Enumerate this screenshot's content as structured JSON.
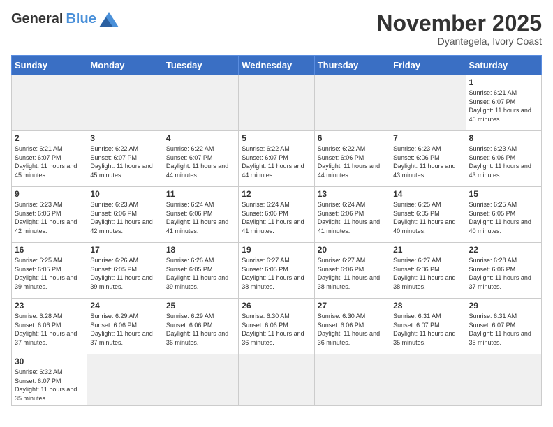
{
  "header": {
    "logo_general": "General",
    "logo_blue": "Blue",
    "title": "November 2025",
    "location": "Dyantegela, Ivory Coast"
  },
  "weekdays": [
    "Sunday",
    "Monday",
    "Tuesday",
    "Wednesday",
    "Thursday",
    "Friday",
    "Saturday"
  ],
  "weeks": [
    [
      {
        "day": "",
        "text": ""
      },
      {
        "day": "",
        "text": ""
      },
      {
        "day": "",
        "text": ""
      },
      {
        "day": "",
        "text": ""
      },
      {
        "day": "",
        "text": ""
      },
      {
        "day": "",
        "text": ""
      },
      {
        "day": "1",
        "text": "Sunrise: 6:21 AM\nSunset: 6:07 PM\nDaylight: 11 hours and 46 minutes."
      }
    ],
    [
      {
        "day": "2",
        "text": "Sunrise: 6:21 AM\nSunset: 6:07 PM\nDaylight: 11 hours and 45 minutes."
      },
      {
        "day": "3",
        "text": "Sunrise: 6:22 AM\nSunset: 6:07 PM\nDaylight: 11 hours and 45 minutes."
      },
      {
        "day": "4",
        "text": "Sunrise: 6:22 AM\nSunset: 6:07 PM\nDaylight: 11 hours and 44 minutes."
      },
      {
        "day": "5",
        "text": "Sunrise: 6:22 AM\nSunset: 6:07 PM\nDaylight: 11 hours and 44 minutes."
      },
      {
        "day": "6",
        "text": "Sunrise: 6:22 AM\nSunset: 6:06 PM\nDaylight: 11 hours and 44 minutes."
      },
      {
        "day": "7",
        "text": "Sunrise: 6:23 AM\nSunset: 6:06 PM\nDaylight: 11 hours and 43 minutes."
      },
      {
        "day": "8",
        "text": "Sunrise: 6:23 AM\nSunset: 6:06 PM\nDaylight: 11 hours and 43 minutes."
      }
    ],
    [
      {
        "day": "9",
        "text": "Sunrise: 6:23 AM\nSunset: 6:06 PM\nDaylight: 11 hours and 42 minutes."
      },
      {
        "day": "10",
        "text": "Sunrise: 6:23 AM\nSunset: 6:06 PM\nDaylight: 11 hours and 42 minutes."
      },
      {
        "day": "11",
        "text": "Sunrise: 6:24 AM\nSunset: 6:06 PM\nDaylight: 11 hours and 41 minutes."
      },
      {
        "day": "12",
        "text": "Sunrise: 6:24 AM\nSunset: 6:06 PM\nDaylight: 11 hours and 41 minutes."
      },
      {
        "day": "13",
        "text": "Sunrise: 6:24 AM\nSunset: 6:06 PM\nDaylight: 11 hours and 41 minutes."
      },
      {
        "day": "14",
        "text": "Sunrise: 6:25 AM\nSunset: 6:05 PM\nDaylight: 11 hours and 40 minutes."
      },
      {
        "day": "15",
        "text": "Sunrise: 6:25 AM\nSunset: 6:05 PM\nDaylight: 11 hours and 40 minutes."
      }
    ],
    [
      {
        "day": "16",
        "text": "Sunrise: 6:25 AM\nSunset: 6:05 PM\nDaylight: 11 hours and 39 minutes."
      },
      {
        "day": "17",
        "text": "Sunrise: 6:26 AM\nSunset: 6:05 PM\nDaylight: 11 hours and 39 minutes."
      },
      {
        "day": "18",
        "text": "Sunrise: 6:26 AM\nSunset: 6:05 PM\nDaylight: 11 hours and 39 minutes."
      },
      {
        "day": "19",
        "text": "Sunrise: 6:27 AM\nSunset: 6:05 PM\nDaylight: 11 hours and 38 minutes."
      },
      {
        "day": "20",
        "text": "Sunrise: 6:27 AM\nSunset: 6:06 PM\nDaylight: 11 hours and 38 minutes."
      },
      {
        "day": "21",
        "text": "Sunrise: 6:27 AM\nSunset: 6:06 PM\nDaylight: 11 hours and 38 minutes."
      },
      {
        "day": "22",
        "text": "Sunrise: 6:28 AM\nSunset: 6:06 PM\nDaylight: 11 hours and 37 minutes."
      }
    ],
    [
      {
        "day": "23",
        "text": "Sunrise: 6:28 AM\nSunset: 6:06 PM\nDaylight: 11 hours and 37 minutes."
      },
      {
        "day": "24",
        "text": "Sunrise: 6:29 AM\nSunset: 6:06 PM\nDaylight: 11 hours and 37 minutes."
      },
      {
        "day": "25",
        "text": "Sunrise: 6:29 AM\nSunset: 6:06 PM\nDaylight: 11 hours and 36 minutes."
      },
      {
        "day": "26",
        "text": "Sunrise: 6:30 AM\nSunset: 6:06 PM\nDaylight: 11 hours and 36 minutes."
      },
      {
        "day": "27",
        "text": "Sunrise: 6:30 AM\nSunset: 6:06 PM\nDaylight: 11 hours and 36 minutes."
      },
      {
        "day": "28",
        "text": "Sunrise: 6:31 AM\nSunset: 6:07 PM\nDaylight: 11 hours and 35 minutes."
      },
      {
        "day": "29",
        "text": "Sunrise: 6:31 AM\nSunset: 6:07 PM\nDaylight: 11 hours and 35 minutes."
      }
    ],
    [
      {
        "day": "30",
        "text": "Sunrise: 6:32 AM\nSunset: 6:07 PM\nDaylight: 11 hours and 35 minutes."
      },
      {
        "day": "",
        "text": ""
      },
      {
        "day": "",
        "text": ""
      },
      {
        "day": "",
        "text": ""
      },
      {
        "day": "",
        "text": ""
      },
      {
        "day": "",
        "text": ""
      },
      {
        "day": "",
        "text": ""
      }
    ]
  ]
}
